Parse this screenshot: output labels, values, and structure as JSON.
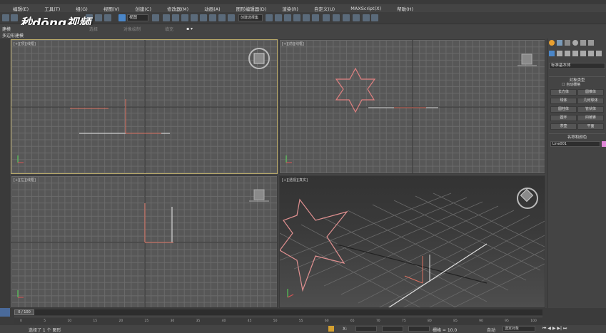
{
  "menu": [
    "编辑(E)",
    "工具(T)",
    "组(G)",
    "视图(V)",
    "创建(C)",
    "修改器(M)",
    "动画(A)",
    "图形编辑器(D)",
    "渲染(R)",
    "自定义(U)",
    "MAXScript(X)",
    "帮助(H)"
  ],
  "toolbar": {
    "view_select": "视图",
    "named_sel": "创建选择集"
  },
  "ribbon": {
    "tabs": [
      "建模",
      "自由形式",
      "选择",
      "对象绘制",
      "填充"
    ],
    "sub": "多边形建模"
  },
  "logo": "秒dōng视频",
  "viewports": {
    "top": "[+][顶][线框]",
    "front": "[+][前][线框]",
    "left": "[+][左][线框]",
    "persp": "[+][透视][真实]"
  },
  "panel": {
    "category": "标准基本体",
    "rollout_type": "对象类型",
    "autogrid": "自动栅格",
    "buttons": [
      [
        "长方体",
        "圆锥体"
      ],
      [
        "球体",
        "几何球体"
      ],
      [
        "圆柱体",
        "管状体"
      ],
      [
        "圆环",
        "四棱锥"
      ],
      [
        "茶壶",
        "平面"
      ]
    ],
    "rollout_name": "名称和颜色",
    "name_value": "Line001",
    "color": "#e087d8"
  },
  "timeline": {
    "frame": "0 / 100",
    "ticks": [
      "0",
      "5",
      "10",
      "15",
      "20",
      "25",
      "30",
      "35",
      "40",
      "45",
      "50",
      "55",
      "60",
      "65",
      "70",
      "75",
      "80",
      "85",
      "90",
      "95",
      "100"
    ]
  },
  "status": {
    "selected": "选择了 1 个 图形",
    "grid": "栅格 = 10.0",
    "auto": "自动",
    "sel_filter": "选定对象"
  }
}
